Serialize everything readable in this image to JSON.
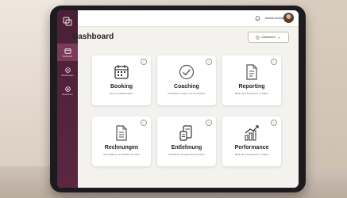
{
  "sidebar": {
    "items": [
      {
        "label": "Dashboard",
        "icon": "dashboard-icon"
      },
      {
        "label": "Einstellungen",
        "icon": "settings-icon"
      },
      {
        "label": "Ressourcen",
        "icon": "resources-icon"
      }
    ]
  },
  "topbar": {
    "user_name": "Admin-ivekat"
  },
  "page": {
    "title": "Dashboard",
    "dropdown_label": "Dashboard"
  },
  "cards": [
    {
      "title": "Booking",
      "subtitle": "Buch- ja reaktioningsen",
      "icon": "calendar-icon"
    },
    {
      "title": "Coaching",
      "subtitle": "Koordination: beginn von Koordination",
      "icon": "check-circle-icon"
    },
    {
      "title": "Reporting",
      "subtitle": "Beide rame kreporter ih to mitgres",
      "icon": "document-icon"
    },
    {
      "title": "Rechnungen",
      "subtitle": "Kommittations: an dieKelke fur.mede",
      "icon": "invoice-icon"
    },
    {
      "title": "Entlehnung",
      "subtitle": "Selbstdeite: at ingehe ferutrsionsefre",
      "icon": "devices-icon"
    },
    {
      "title": "Performance",
      "subtitle": "Beide rame kreporter ih to mitgres",
      "icon": "chart-icon"
    }
  ],
  "colors": {
    "sidebar": "#4a2036",
    "accent": "#7a3a5a"
  }
}
